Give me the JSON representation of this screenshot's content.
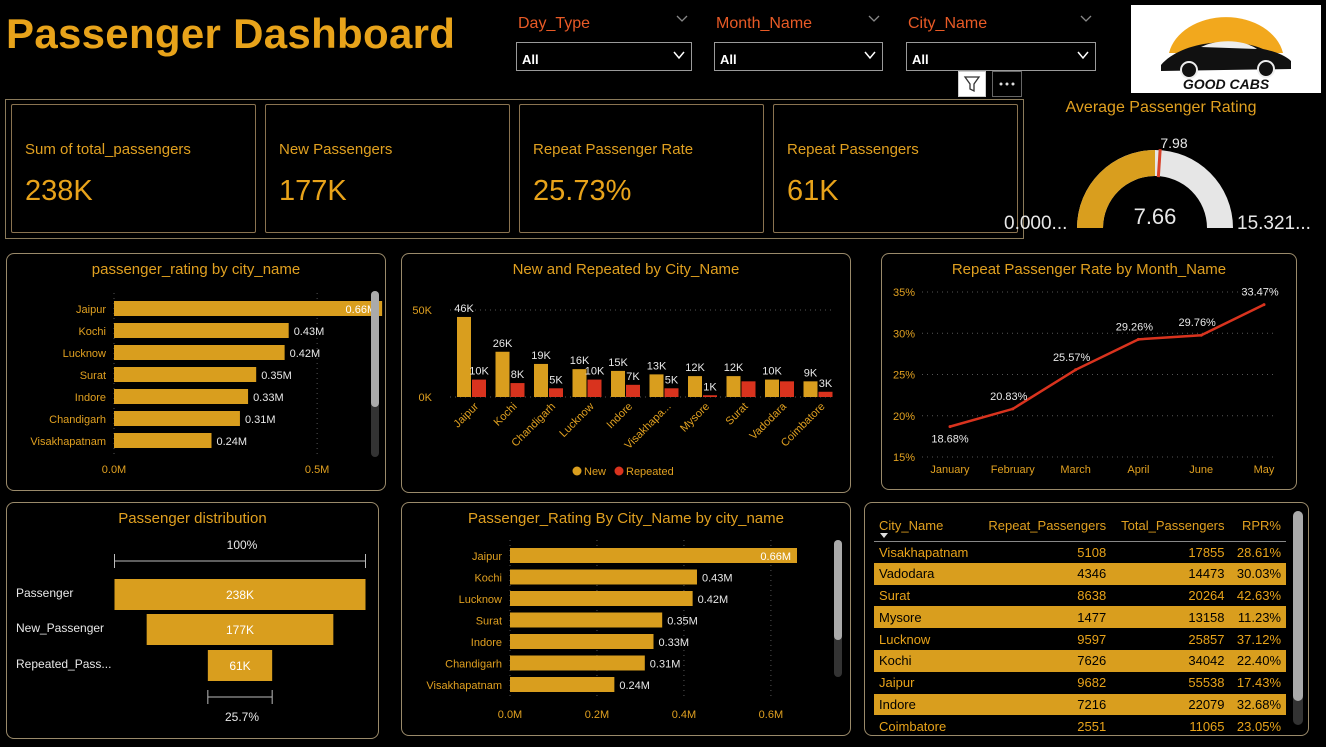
{
  "header": {
    "title": "Passenger Dashboard"
  },
  "slicers": [
    {
      "label": "Day_Type",
      "value": "All"
    },
    {
      "label": "Month_Name",
      "value": "All"
    },
    {
      "label": "City_Name",
      "value": "All"
    }
  ],
  "logo": {
    "text": "GOOD CABS"
  },
  "kpis": [
    {
      "label": "Sum of total_passengers",
      "value": "238K"
    },
    {
      "label": "New Passengers",
      "value": "177K"
    },
    {
      "label": "Repeat Passenger Rate",
      "value": "25.73%"
    },
    {
      "label": "Repeat Passengers",
      "value": "61K"
    }
  ],
  "gauge": {
    "title": "Average Passenger Rating",
    "value_label": "7.66",
    "target_label": "7.98",
    "min_label": "0.000...",
    "max_label": "15.321...",
    "value": 7.66,
    "target": 7.98,
    "min": 0,
    "max": 15.321,
    "colors": {
      "fill": "#d99e1e",
      "rest": "#e6e6e6",
      "target": "#d9412a"
    }
  },
  "chart_data": [
    {
      "id": "rating_by_city",
      "type": "bar",
      "orientation": "horizontal",
      "title": "passenger_rating by city_name",
      "categories": [
        "Jaipur",
        "Kochi",
        "Lucknow",
        "Surat",
        "Indore",
        "Chandigarh",
        "Visakhapatnam"
      ],
      "values": [
        0.66,
        0.43,
        0.42,
        0.35,
        0.33,
        0.31,
        0.24
      ],
      "data_labels": [
        "0.66M",
        "0.43M",
        "0.42M",
        "0.35M",
        "0.33M",
        "0.31M",
        "0.24M"
      ],
      "xticks": [
        "0.0M",
        "0.5M"
      ],
      "xlim": [
        0,
        0.8
      ]
    },
    {
      "id": "new_repeated_by_city",
      "type": "bar",
      "title": "New and Repeated by City_Name",
      "categories": [
        "Jaipur",
        "Kochi",
        "Chandigarh",
        "Lucknow",
        "Indore",
        "Visakhapa...",
        "Mysore",
        "Surat",
        "Vadodara",
        "Coimbatore"
      ],
      "series": [
        {
          "name": "New",
          "values": [
            46,
            26,
            19,
            16,
            15,
            13,
            12,
            12,
            10,
            9
          ],
          "labels": [
            "46K",
            "26K",
            "19K",
            "16K",
            "15K",
            "13K",
            "12K",
            "12K",
            "10K",
            "9K"
          ],
          "color": "#d99e1e"
        },
        {
          "name": "Repeated",
          "values": [
            10,
            8,
            5,
            10,
            7,
            5,
            1,
            9,
            9,
            3
          ],
          "labels": [
            "10K",
            "8K",
            "5K",
            "10K",
            "7K",
            "5K",
            "1K",
            "",
            "",
            "3K"
          ],
          "color": "#d9331e"
        }
      ],
      "yticks": [
        "50K",
        "0K"
      ],
      "ylim": [
        0,
        50
      ]
    },
    {
      "id": "rpr_by_month",
      "type": "line",
      "title": "Repeat Passenger Rate by Month_Name",
      "categories": [
        "January",
        "February",
        "March",
        "April",
        "June",
        "May"
      ],
      "values": [
        18.68,
        20.83,
        25.57,
        29.26,
        29.76,
        33.47
      ],
      "data_labels": [
        "18.68%",
        "20.83%",
        "25.57%",
        "29.26%",
        "29.76%",
        "33.47%"
      ],
      "yticks": [
        "35%",
        "30%",
        "25%",
        "20%",
        "15%"
      ],
      "ylim": [
        15,
        35
      ],
      "color": "#d9331e"
    },
    {
      "id": "funnel",
      "type": "bar",
      "orientation": "funnel",
      "title": "Passenger distribution",
      "categories": [
        "Passenger",
        "New_Passenger",
        "Repeated_Pass..."
      ],
      "values": [
        238,
        177,
        61
      ],
      "data_labels": [
        "238K",
        "177K",
        "61K"
      ],
      "top_pct": "100%",
      "bottom_pct": "25.7%"
    },
    {
      "id": "rating_by_city_2",
      "type": "bar",
      "orientation": "horizontal",
      "title": "Passenger_Rating By City_Name by city_name",
      "categories": [
        "Jaipur",
        "Kochi",
        "Lucknow",
        "Surat",
        "Indore",
        "Chandigarh",
        "Visakhapatnam"
      ],
      "values": [
        0.66,
        0.43,
        0.42,
        0.35,
        0.33,
        0.31,
        0.24
      ],
      "data_labels": [
        "0.66M",
        "0.43M",
        "0.42M",
        "0.35M",
        "0.33M",
        "0.31M",
        "0.24M"
      ],
      "xticks": [
        "0.0M",
        "0.2M",
        "0.4M",
        "0.6M"
      ],
      "xlim": [
        0,
        0.66
      ]
    },
    {
      "id": "city_table",
      "type": "table",
      "columns": [
        "City_Name",
        "Repeat_Passengers",
        "Total_Passengers",
        "RPR%"
      ],
      "rows": [
        [
          "Visakhapatnam",
          "5108",
          "17855",
          "28.61%"
        ],
        [
          "Vadodara",
          "4346",
          "14473",
          "30.03%"
        ],
        [
          "Surat",
          "8638",
          "20264",
          "42.63%"
        ],
        [
          "Mysore",
          "1477",
          "13158",
          "11.23%"
        ],
        [
          "Lucknow",
          "9597",
          "25857",
          "37.12%"
        ],
        [
          "Kochi",
          "7626",
          "34042",
          "22.40%"
        ],
        [
          "Jaipur",
          "9682",
          "55538",
          "17.43%"
        ],
        [
          "Indore",
          "7216",
          "22079",
          "32.68%"
        ],
        [
          "Coimbatore",
          "2551",
          "11065",
          "23.05%"
        ]
      ]
    }
  ]
}
